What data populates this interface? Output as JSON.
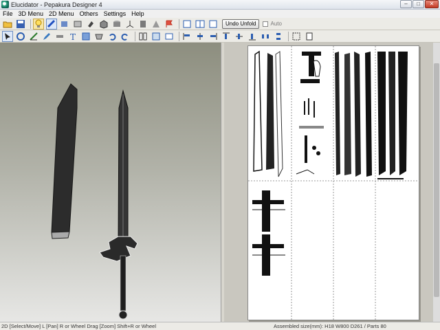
{
  "window": {
    "title": "Elucidator - Pepakura Designer 4",
    "minimize": "–",
    "maximize": "□",
    "close": "✕"
  },
  "menu": {
    "items": [
      "File",
      "3D Menu",
      "2D Menu",
      "Others",
      "Settings",
      "Help"
    ]
  },
  "toolbar1": {
    "icons": [
      "open-folder-icon",
      "save-icon",
      "light-bulb-icon",
      "texture-icon",
      "rotate-icon",
      "paint-icon",
      "colour-icon",
      "join-icon",
      "axis-icon",
      "cylinder-icon",
      "cube-icon",
      "person-icon",
      "flag-icon",
      "single-view-icon",
      "dual-view-icon",
      "page-view-icon"
    ],
    "unfold_label": "Undo Unfold",
    "auto_label": "Auto"
  },
  "toolbar2": {
    "icons": [
      "select-icon",
      "rotate-part-icon",
      "cut-icon",
      "pen-icon",
      "line-icon",
      "text-icon",
      "image-icon",
      "flap-icon",
      "undo-icon",
      "redo-icon",
      "columns-icon",
      "fit-icon",
      "layers-icon",
      "align-left-icon",
      "align-center-icon",
      "align-right-icon",
      "align-top-icon",
      "align-middle-icon",
      "align-bottom-icon",
      "distribute-h-icon",
      "distribute-v-icon",
      "zoom-fit-icon",
      "zoom-page-icon"
    ]
  },
  "status": {
    "left": "2D [Select/Move] L [Pan] R or Wheel Drag [Zoom] Shift+R or Wheel",
    "right": "Assembled size(mm): H18 W800 D261 / Parts 80"
  }
}
